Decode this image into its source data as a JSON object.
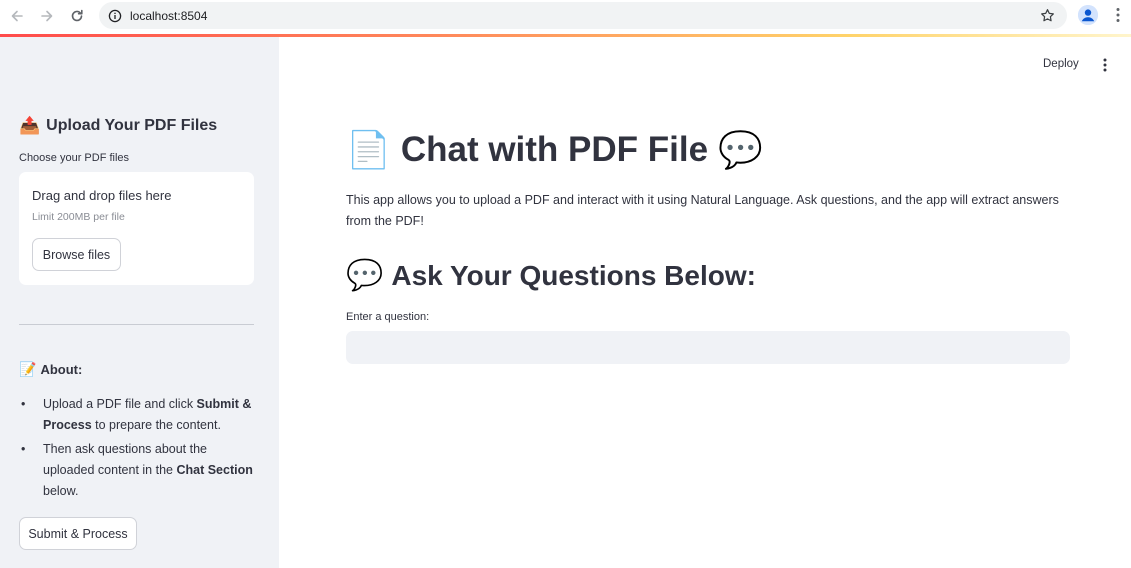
{
  "browser": {
    "url": "localhost:8504",
    "icons": [
      "back-icon",
      "forward-icon",
      "reload-icon",
      "site-info-icon",
      "bookmark-star-icon",
      "profile-icon",
      "browser-menu-icon"
    ]
  },
  "colors": {
    "sidebar_bg": "#f0f2f6",
    "text": "#31333f",
    "accent_line": "#ff4b4b",
    "input_bg": "#f0f2f6"
  },
  "sidebar": {
    "upload_emoji": "📤",
    "upload_heading": "Upload Your PDF Files",
    "choose_label": "Choose your PDF files",
    "dropzone": {
      "title": "Drag and drop files here",
      "limit": "Limit 200MB per file",
      "browse_label": "Browse files"
    },
    "about_emoji": "📝",
    "about_heading": "About:",
    "about_items": [
      {
        "pre": "Upload a PDF file and click ",
        "bold": "Submit & Process",
        "post": " to prepare the content."
      },
      {
        "pre": "Then ask questions about the uploaded content in the ",
        "bold": "Chat Section",
        "post": " below."
      }
    ],
    "submit_label": "Submit & Process"
  },
  "header": {
    "deploy_label": "Deploy"
  },
  "main": {
    "title_emoji_left": "📄",
    "title": "Chat with PDF File",
    "title_emoji_right": "💬",
    "intro": "This app allows you to upload a PDF and interact with it using Natural Language. Ask questions, and the app will extract answers from the PDF!",
    "questions_emoji": "💬",
    "questions_heading": "Ask Your Questions Below:",
    "question_label": "Enter a question:",
    "question_value": ""
  }
}
